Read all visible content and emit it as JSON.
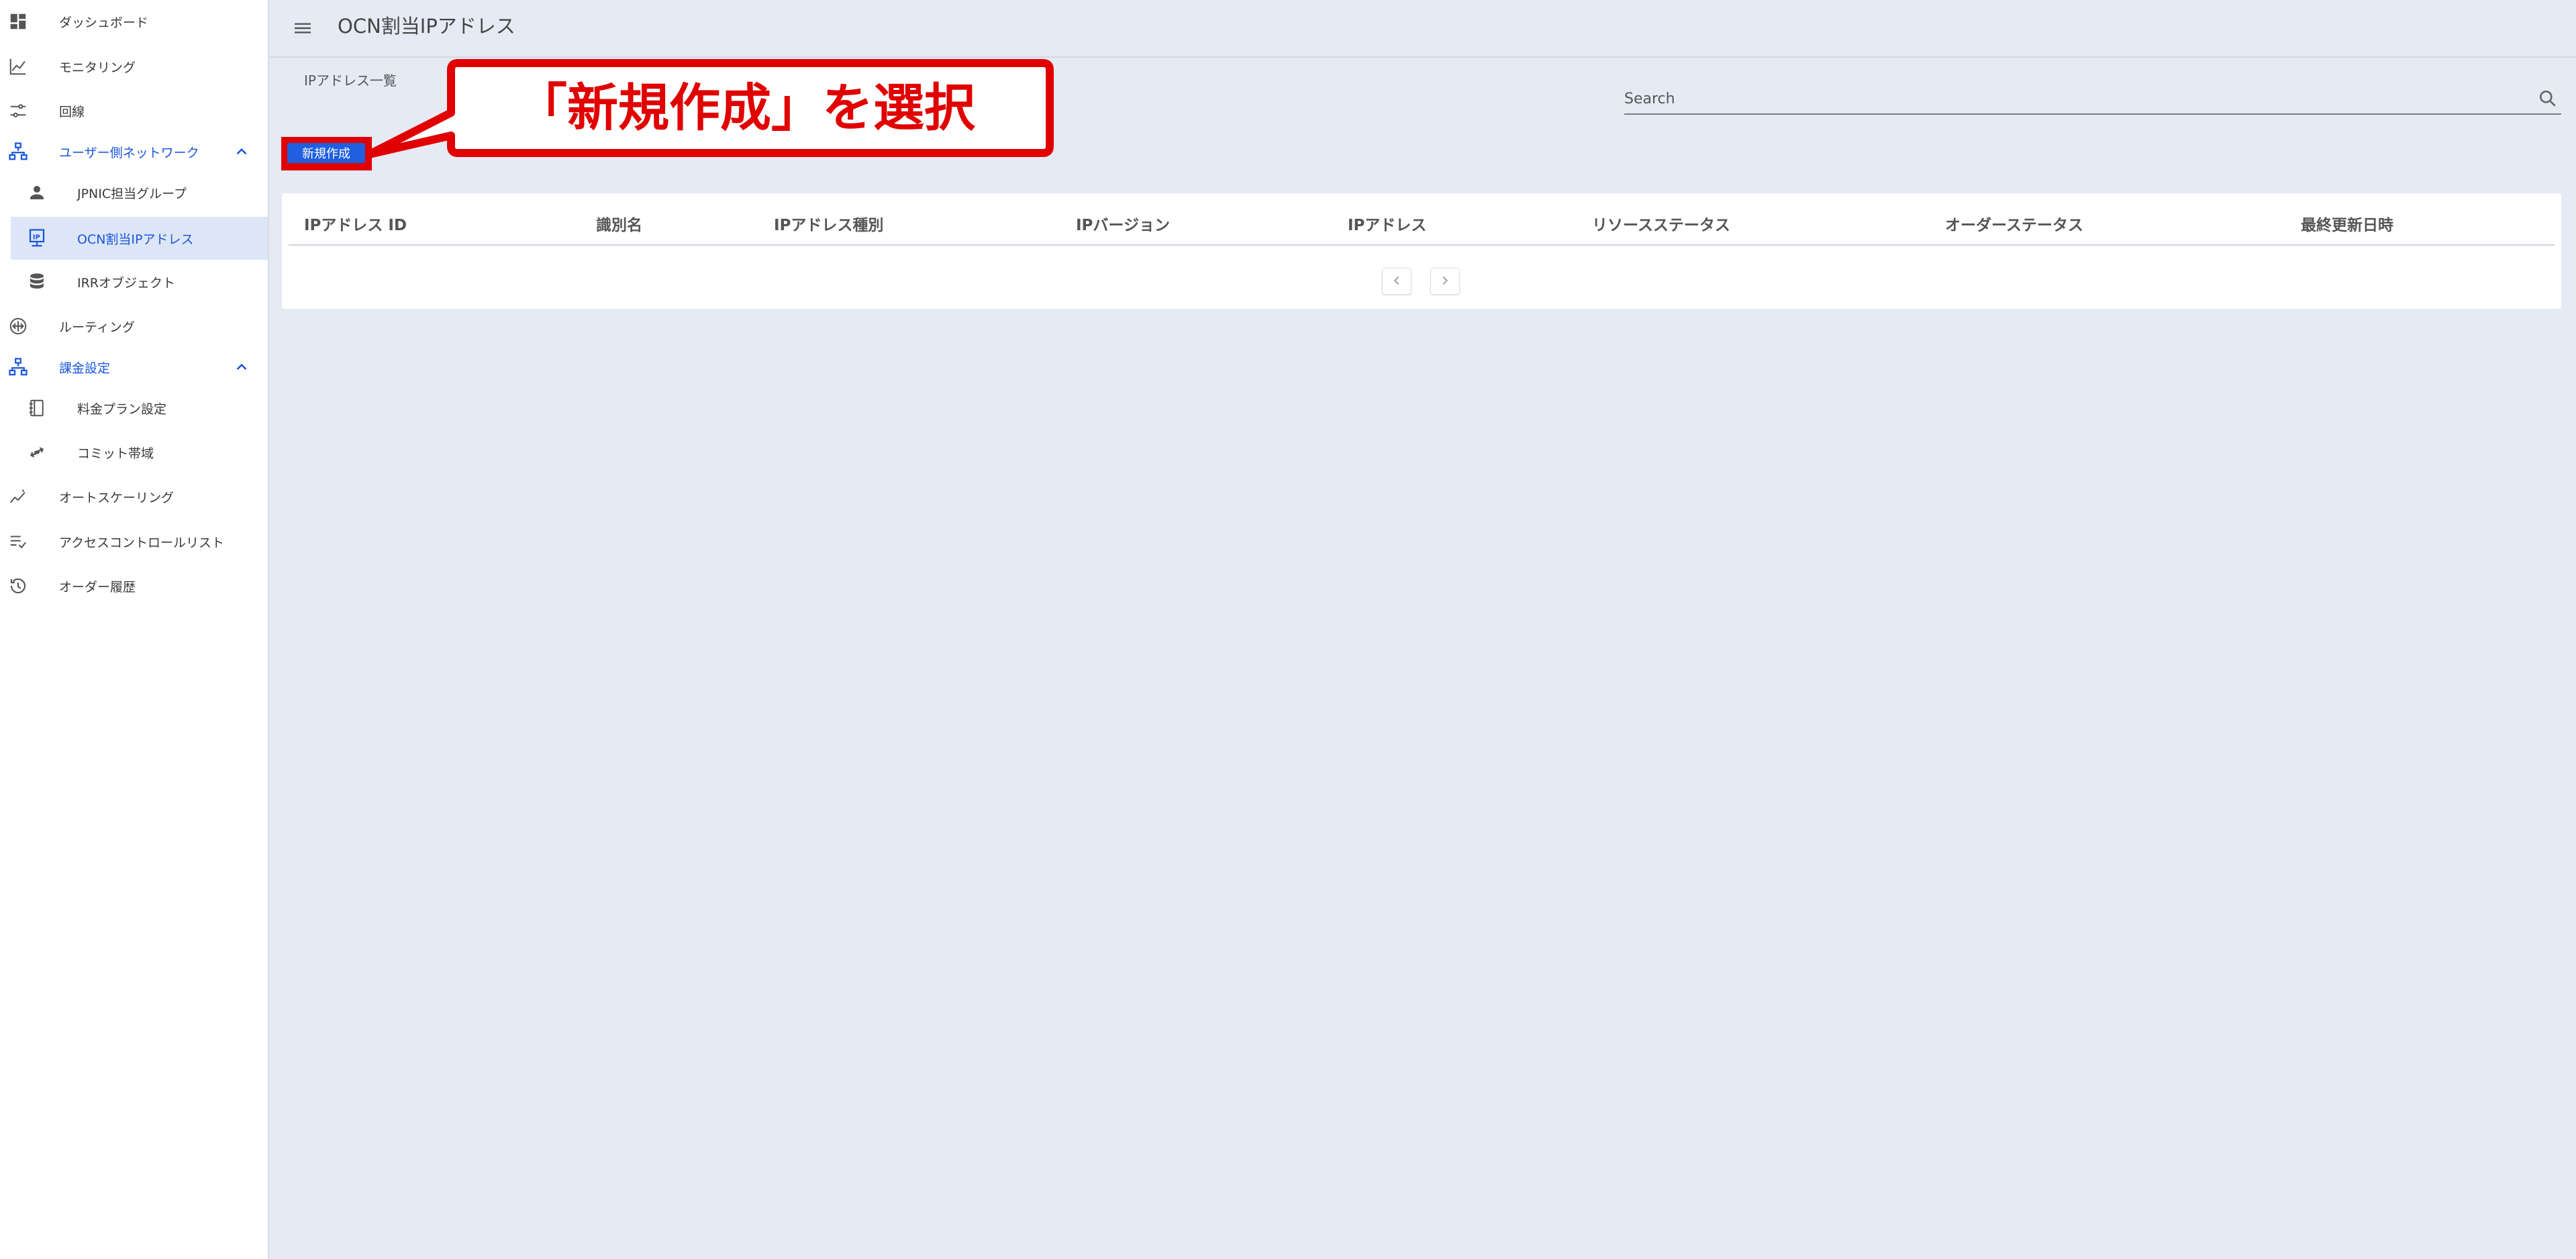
{
  "header": {
    "title": "OCN割当IPアドレス",
    "menu_icon": "hamburger-menu-icon"
  },
  "sidebar": {
    "items": [
      {
        "label": "ダッシュボード",
        "icon": "dashboard-icon"
      },
      {
        "label": "モニタリング",
        "icon": "line-chart-icon"
      },
      {
        "label": "回線",
        "icon": "tune-icon"
      },
      {
        "label": "ユーザー側ネットワーク",
        "icon": "network-icon",
        "expanded": true
      },
      {
        "label": "JPNIC担当グループ",
        "icon": "person-icon"
      },
      {
        "label": "OCN割当IPアドレス",
        "icon": "ip-icon",
        "active": true
      },
      {
        "label": "IRRオブジェクト",
        "icon": "database-icon"
      },
      {
        "label": "ルーティング",
        "icon": "routing-icon"
      },
      {
        "label": "課金設定",
        "icon": "network-icon",
        "expanded": true
      },
      {
        "label": "料金プラン設定",
        "icon": "notebook-icon"
      },
      {
        "label": "コミット帯域",
        "icon": "transfer-icon"
      },
      {
        "label": "オートスケーリング",
        "icon": "auto-graph-icon"
      },
      {
        "label": "アクセスコントロールリスト",
        "icon": "playlist-check-icon"
      },
      {
        "label": "オーダー履歴",
        "icon": "history-icon"
      }
    ]
  },
  "breadcrumb": "IPアドレス一覧",
  "search": {
    "placeholder": "Search"
  },
  "actions": {
    "new_label": "新規作成"
  },
  "callout": {
    "text": "「新規作成」を選択"
  },
  "table": {
    "columns": [
      "IPアドレス ID",
      "識別名",
      "IPアドレス種別",
      "IPバージョン",
      "IPアドレス",
      "リソースステータス",
      "オーダーステータス",
      "最終更新日時"
    ],
    "rows": []
  },
  "colors": {
    "accent": "#1a56db",
    "highlight": "#e00000",
    "background": "#e6eaf4"
  }
}
